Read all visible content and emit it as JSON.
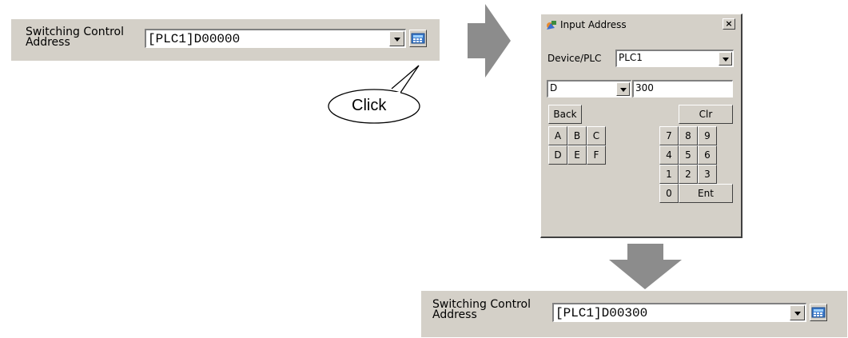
{
  "before": {
    "label": "Switching Control Address",
    "label_line1": "Switching Control",
    "label_line2": "Address",
    "value": "[PLC1]D00000"
  },
  "callout": {
    "text": "Click"
  },
  "dialog": {
    "title": "Input Address",
    "close": "×",
    "device_label": "Device/PLC",
    "device_value": "PLC1",
    "device_type": "D",
    "address_value": "300",
    "back": "Back",
    "clr": "Clr",
    "hex_keys": [
      "A",
      "B",
      "C",
      "D",
      "E",
      "F"
    ],
    "num_keys": [
      "7",
      "8",
      "9",
      "4",
      "5",
      "6",
      "1",
      "2",
      "3",
      "0"
    ],
    "ent": "Ent"
  },
  "after": {
    "label_line1": "Switching Control",
    "label_line2": "Address",
    "value": "[PLC1]D00300"
  },
  "colors": {
    "panel": "#d4d0c8",
    "arrow": "#8c8c8c"
  }
}
